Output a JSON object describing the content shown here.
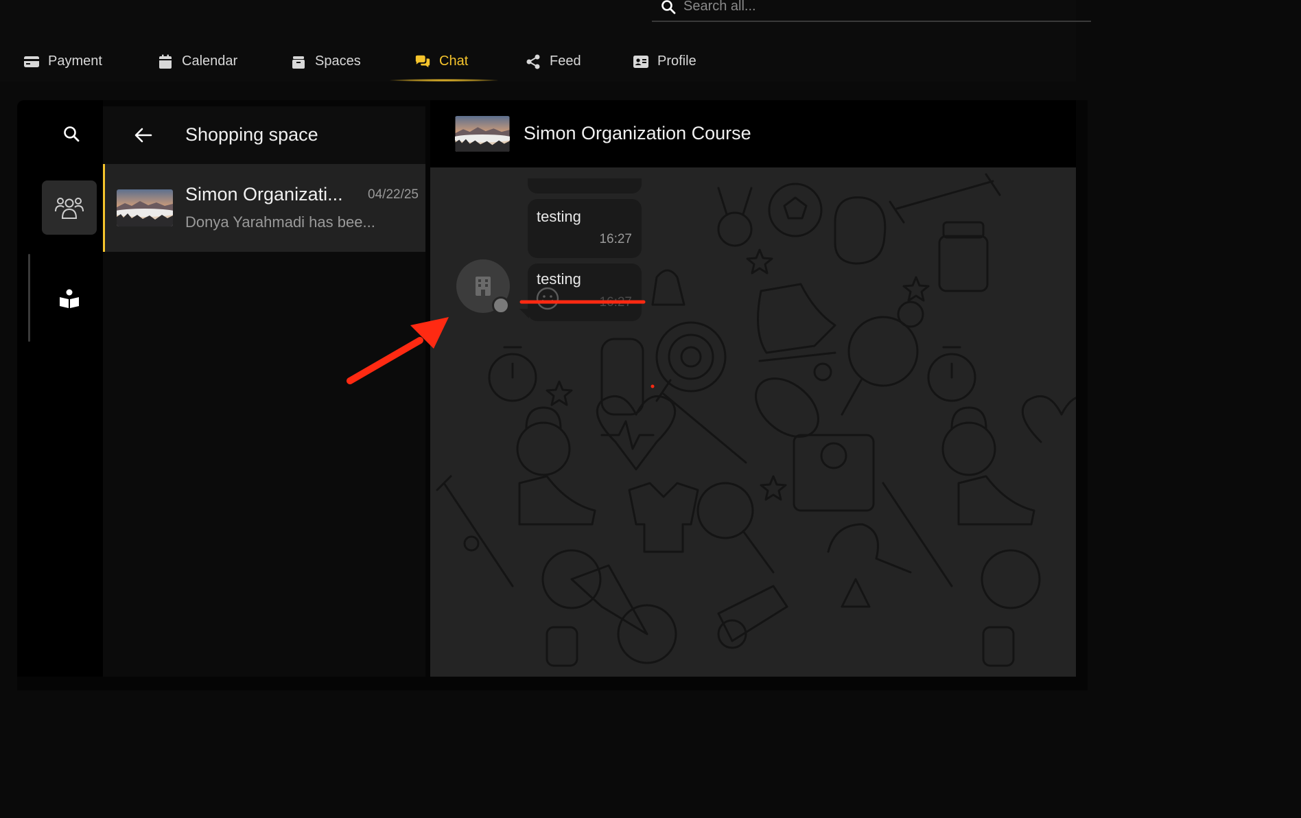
{
  "search": {
    "placeholder": "Search all..."
  },
  "nav": {
    "items": [
      {
        "label": "Payment",
        "icon": "credit-card-icon"
      },
      {
        "label": "Calendar",
        "icon": "calendar-icon"
      },
      {
        "label": "Spaces",
        "icon": "spaces-icon"
      },
      {
        "label": "Chat",
        "icon": "chat-bubbles-icon",
        "active": true
      },
      {
        "label": "Feed",
        "icon": "share-icon"
      },
      {
        "label": "Profile",
        "icon": "id-card-icon"
      }
    ],
    "active_color": "#f5c42c"
  },
  "rail": {
    "icons": [
      "search-icon",
      "groups-icon",
      "book-reader-icon"
    ]
  },
  "list": {
    "title": "Shopping space",
    "items": [
      {
        "name": "Simon Organizati...",
        "date": "04/22/25",
        "preview": "Donya Yarahmadi has bee..."
      }
    ]
  },
  "conversation": {
    "title": "Simon Organization Course",
    "messages": [
      {
        "text": "testing",
        "time": "16:27"
      },
      {
        "text": "testing",
        "time": "16:27"
      }
    ]
  },
  "colors": {
    "accent": "#f5c42c",
    "annotation": "#ff2a12"
  }
}
